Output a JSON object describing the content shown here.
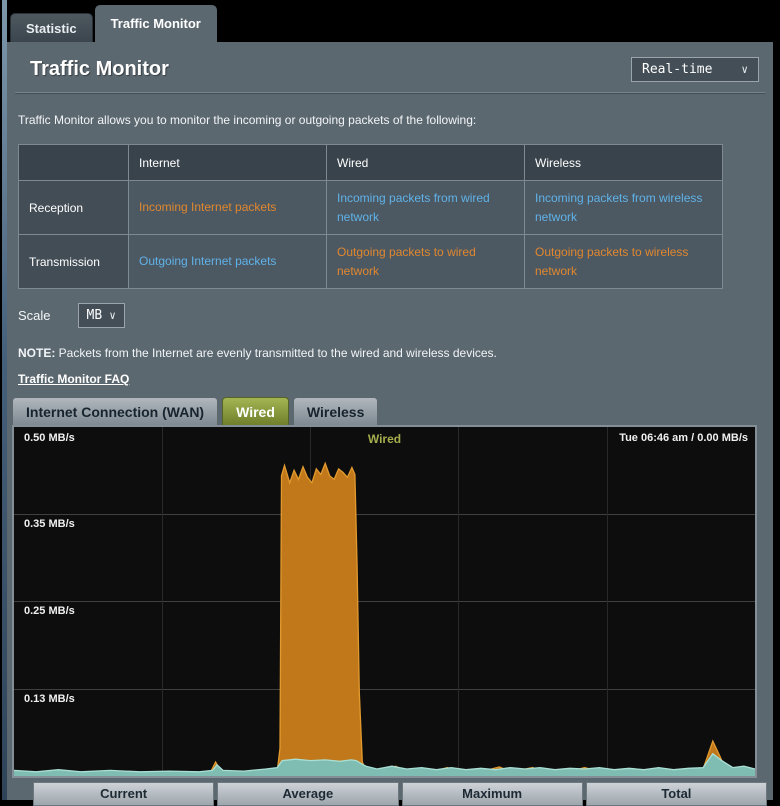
{
  "page": {
    "top_tabs": [
      {
        "label": "Statistic",
        "active": false
      },
      {
        "label": "Traffic Monitor",
        "active": true
      }
    ],
    "title": "Traffic Monitor",
    "mode_select": {
      "value": "Real-time"
    },
    "description": "Traffic Monitor allows you to monitor the incoming or outgoing packets of the following:",
    "legend_table": {
      "headers": [
        "",
        "Internet",
        "Wired",
        "Wireless"
      ],
      "rows": [
        {
          "label": "Reception",
          "cells": [
            {
              "text": "Incoming Internet packets",
              "color": "orange"
            },
            {
              "text": "Incoming packets from wired network",
              "color": "blue"
            },
            {
              "text": "Incoming packets from wireless network",
              "color": "blue"
            }
          ]
        },
        {
          "label": "Transmission",
          "cells": [
            {
              "text": "Outgoing Internet packets",
              "color": "blue"
            },
            {
              "text": "Outgoing packets to wired network",
              "color": "orange"
            },
            {
              "text": "Outgoing packets to wireless network",
              "color": "orange"
            }
          ]
        }
      ]
    },
    "scale": {
      "label": "Scale",
      "value": "MB"
    },
    "note_bold": "NOTE:",
    "note_text": " Packets from the Internet are evenly transmitted to the wired and wireless devices.",
    "faq_link": "Traffic Monitor FAQ",
    "chart_tabs": [
      {
        "label": "Internet Connection (WAN)",
        "active": false
      },
      {
        "label": "Wired",
        "active": true
      },
      {
        "label": "Wireless",
        "active": false
      }
    ],
    "footer_headers": [
      "Current",
      "Average",
      "Maximum",
      "Total"
    ],
    "chevron": "∨"
  },
  "colors": {
    "accent_orange": "#e0872f",
    "accent_blue": "#5fb2e9",
    "chart_orange_fill": "#c1781a",
    "chart_orange_stroke": "#e29a2e",
    "chart_teal_fill": "#7fbdb3",
    "chart_teal_stroke": "#a9ded3",
    "active_tab_green": "#8ea23b",
    "panel_gray": "#5c6870"
  },
  "chart_data": {
    "type": "area",
    "title": "Wired",
    "status_text": "Tue 06:46 am / 0.00 MB/s",
    "unit": "MB/s",
    "ylim": [
      0,
      0.5
    ],
    "ytick_labels": [
      "0.50 MB/s",
      "0.35 MB/s",
      "0.25 MB/s",
      "0.13 MB/s"
    ],
    "grid": {
      "h_fracs": [
        0.25,
        0.5,
        0.75
      ],
      "v_fracs": [
        0.2,
        0.4,
        0.6,
        0.8
      ]
    },
    "legend_position": "none",
    "series": [
      {
        "name": "transmission-outgoing-to-wired",
        "fill": "#c1781a",
        "stroke": "#e29a2e",
        "points": [
          [
            0,
            0.006
          ],
          [
            0.02,
            0.004
          ],
          [
            0.05,
            0.007
          ],
          [
            0.08,
            0.004
          ],
          [
            0.12,
            0.006
          ],
          [
            0.16,
            0.004
          ],
          [
            0.2,
            0.005
          ],
          [
            0.24,
            0.004
          ],
          [
            0.265,
            0.005
          ],
          [
            0.272,
            0.02
          ],
          [
            0.28,
            0.005
          ],
          [
            0.3,
            0.004
          ],
          [
            0.33,
            0.005
          ],
          [
            0.355,
            0.005
          ],
          [
            0.359,
            0.04
          ],
          [
            0.361,
            0.43
          ],
          [
            0.365,
            0.445
          ],
          [
            0.372,
            0.42
          ],
          [
            0.378,
            0.438
          ],
          [
            0.384,
            0.425
          ],
          [
            0.39,
            0.443
          ],
          [
            0.396,
            0.428
          ],
          [
            0.402,
            0.42
          ],
          [
            0.408,
            0.44
          ],
          [
            0.414,
            0.432
          ],
          [
            0.42,
            0.448
          ],
          [
            0.426,
            0.43
          ],
          [
            0.432,
            0.425
          ],
          [
            0.438,
            0.44
          ],
          [
            0.444,
            0.435
          ],
          [
            0.45,
            0.428
          ],
          [
            0.456,
            0.442
          ],
          [
            0.46,
            0.432
          ],
          [
            0.463,
            0.3
          ],
          [
            0.466,
            0.12
          ],
          [
            0.47,
            0.02
          ],
          [
            0.475,
            0.008
          ],
          [
            0.5,
            0.006
          ],
          [
            0.515,
            0.014
          ],
          [
            0.53,
            0.006
          ],
          [
            0.56,
            0.005
          ],
          [
            0.585,
            0.012
          ],
          [
            0.6,
            0.005
          ],
          [
            0.63,
            0.006
          ],
          [
            0.655,
            0.013
          ],
          [
            0.67,
            0.006
          ],
          [
            0.7,
            0.012
          ],
          [
            0.715,
            0.006
          ],
          [
            0.75,
            0.006
          ],
          [
            0.77,
            0.012
          ],
          [
            0.79,
            0.006
          ],
          [
            0.82,
            0.008
          ],
          [
            0.85,
            0.006
          ],
          [
            0.88,
            0.01
          ],
          [
            0.9,
            0.006
          ],
          [
            0.93,
            0.01
          ],
          [
            0.943,
            0.05
          ],
          [
            0.952,
            0.03
          ],
          [
            0.96,
            0.01
          ],
          [
            0.98,
            0.008
          ],
          [
            1,
            0.01
          ]
        ]
      },
      {
        "name": "reception-incoming-from-wired",
        "fill": "#7fbdb3",
        "stroke": "#a9ded3",
        "points": [
          [
            0,
            0.008
          ],
          [
            0.03,
            0.006
          ],
          [
            0.06,
            0.009
          ],
          [
            0.09,
            0.006
          ],
          [
            0.13,
            0.008
          ],
          [
            0.17,
            0.006
          ],
          [
            0.21,
            0.007
          ],
          [
            0.25,
            0.006
          ],
          [
            0.268,
            0.008
          ],
          [
            0.274,
            0.016
          ],
          [
            0.282,
            0.008
          ],
          [
            0.31,
            0.007
          ],
          [
            0.34,
            0.01
          ],
          [
            0.355,
            0.012
          ],
          [
            0.362,
            0.022
          ],
          [
            0.38,
            0.024
          ],
          [
            0.4,
            0.022
          ],
          [
            0.42,
            0.023
          ],
          [
            0.44,
            0.021
          ],
          [
            0.455,
            0.023
          ],
          [
            0.462,
            0.022
          ],
          [
            0.468,
            0.018
          ],
          [
            0.475,
            0.014
          ],
          [
            0.49,
            0.01
          ],
          [
            0.51,
            0.014
          ],
          [
            0.53,
            0.01
          ],
          [
            0.55,
            0.012
          ],
          [
            0.57,
            0.009
          ],
          [
            0.59,
            0.012
          ],
          [
            0.61,
            0.009
          ],
          [
            0.63,
            0.011
          ],
          [
            0.65,
            0.009
          ],
          [
            0.67,
            0.012
          ],
          [
            0.69,
            0.01
          ],
          [
            0.71,
            0.012
          ],
          [
            0.73,
            0.009
          ],
          [
            0.75,
            0.011
          ],
          [
            0.77,
            0.01
          ],
          [
            0.79,
            0.012
          ],
          [
            0.81,
            0.009
          ],
          [
            0.83,
            0.011
          ],
          [
            0.85,
            0.009
          ],
          [
            0.87,
            0.012
          ],
          [
            0.89,
            0.009
          ],
          [
            0.91,
            0.011
          ],
          [
            0.93,
            0.012
          ],
          [
            0.943,
            0.032
          ],
          [
            0.955,
            0.022
          ],
          [
            0.97,
            0.012
          ],
          [
            0.985,
            0.014
          ],
          [
            1,
            0.01
          ]
        ]
      }
    ]
  }
}
